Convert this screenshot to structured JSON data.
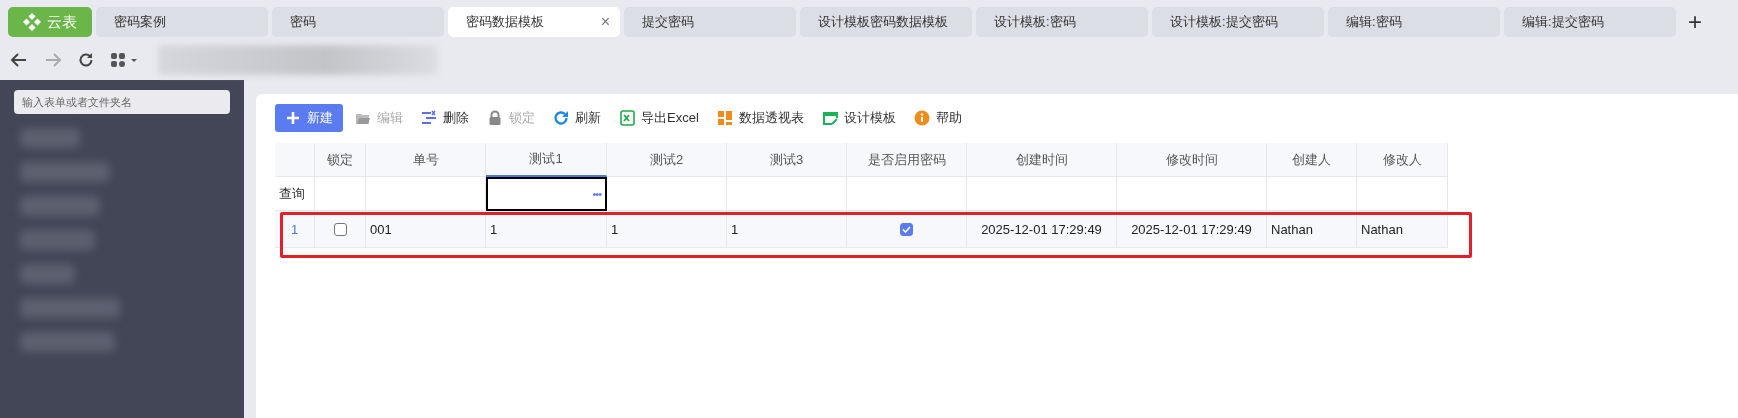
{
  "app_tab": {
    "label": "云表"
  },
  "tabs": [
    {
      "label": "密码案例",
      "selected": false
    },
    {
      "label": "密码",
      "selected": false
    },
    {
      "label": "密码数据模板",
      "selected": true,
      "close": "×"
    },
    {
      "label": "提交密码",
      "selected": false
    },
    {
      "label": "设计模板密码数据模板",
      "selected": false
    },
    {
      "label": "设计模板:密码",
      "selected": false
    },
    {
      "label": "设计模板:提交密码",
      "selected": false
    },
    {
      "label": "编辑:密码",
      "selected": false
    },
    {
      "label": "编辑:提交密码",
      "selected": false
    }
  ],
  "add_tab": "+",
  "sidebar": {
    "search": {
      "placeholder": "输入表单或者文件夹名"
    }
  },
  "toolbar": [
    {
      "kind": "new",
      "label": "新建",
      "disabled": false
    },
    {
      "kind": "edit",
      "label": "编辑",
      "disabled": true
    },
    {
      "kind": "delete",
      "label": "删除",
      "disabled": false
    },
    {
      "kind": "lock",
      "label": "锁定",
      "disabled": true
    },
    {
      "kind": "refresh",
      "label": "刷新",
      "disabled": false
    },
    {
      "kind": "excel",
      "label": "导出Excel",
      "disabled": false
    },
    {
      "kind": "pivot",
      "label": "数据透视表",
      "disabled": false
    },
    {
      "kind": "design",
      "label": "设计模板",
      "disabled": false
    },
    {
      "kind": "help",
      "label": "帮助",
      "disabled": false
    }
  ],
  "table": {
    "columns": [
      {
        "label": "锁定",
        "selected": false
      },
      {
        "label": "单号",
        "selected": false
      },
      {
        "label": "测试1",
        "selected": true
      },
      {
        "label": "测试2",
        "selected": false
      },
      {
        "label": "测试3",
        "selected": false
      },
      {
        "label": "是否启用密码",
        "selected": false
      },
      {
        "label": "创建时间",
        "selected": false
      },
      {
        "label": "修改时间",
        "selected": false
      },
      {
        "label": "创建人",
        "selected": false
      },
      {
        "label": "修改人",
        "selected": false
      }
    ],
    "query_label": "查询",
    "query_more": "•••",
    "rows": [
      {
        "number": "1",
        "locked": false,
        "no": "001",
        "test1": "1",
        "test2": "1",
        "test3": "1",
        "password_enabled": true,
        "created": "2025-12-01 17:29:49",
        "modified": "2025-12-01 17:29:49",
        "creator": "Nathan",
        "modifier": "Nathan",
        "highlighted": true
      }
    ]
  }
}
